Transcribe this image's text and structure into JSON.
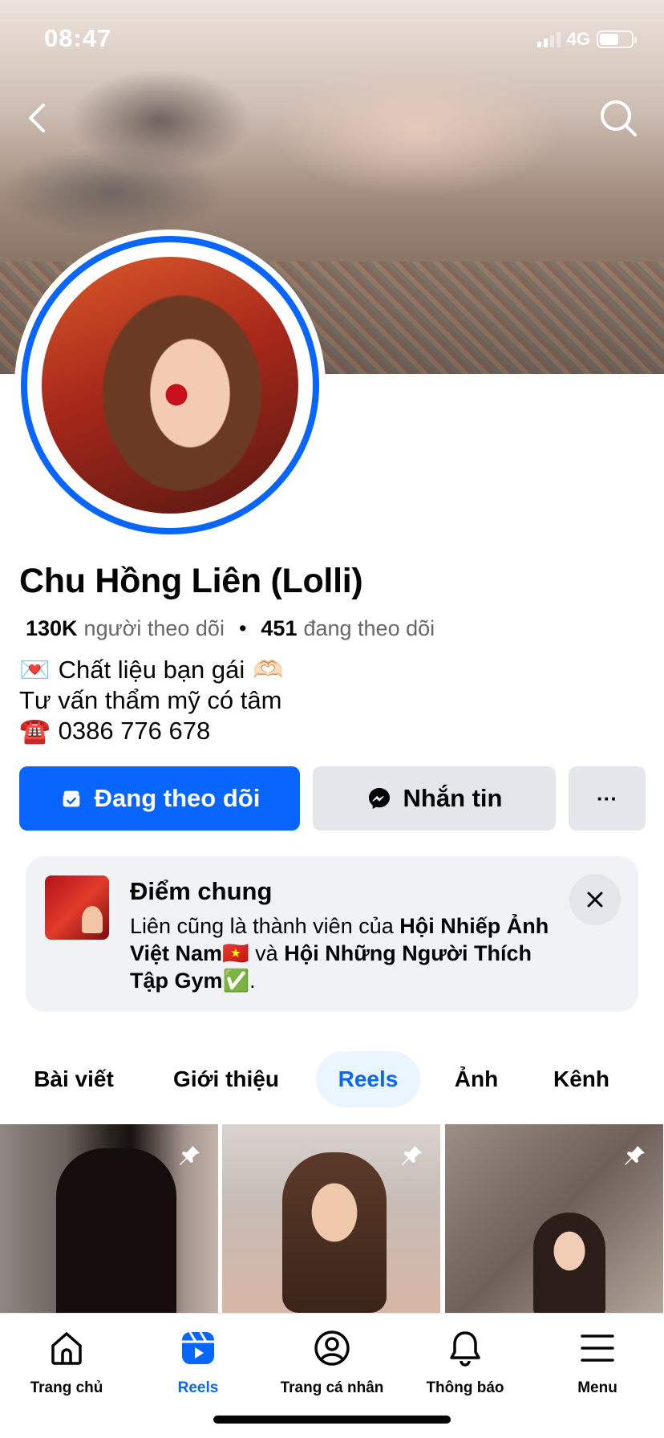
{
  "status_bar": {
    "time": "08:47",
    "network": "4G"
  },
  "profile": {
    "name": "Chu Hồng Liên (Lolli)",
    "followers_count": "130K",
    "followers_label": "người theo dõi",
    "following_count": "451",
    "following_label": "đang theo dõi",
    "separator": "•",
    "bio": [
      {
        "emoji": "💌",
        "text": "Chất liệu bạn gái",
        "trailing": "🫶🏻"
      },
      {
        "emoji": "",
        "text": "Tư vấn thẩm mỹ có tâm",
        "trailing": ""
      },
      {
        "emoji": "☎️",
        "text": "0386 776 678",
        "trailing": ""
      }
    ]
  },
  "actions": {
    "follow_label": "Đang theo dõi",
    "message_label": "Nhắn tin",
    "more_label": "···"
  },
  "mutual": {
    "title": "Điểm chung",
    "text_prefix": "Liên cũng là thành viên của ",
    "group1": "Hội Nhiếp Ảnh Việt Nam🇻🇳",
    "connector": " và ",
    "group2": "Hội Những Người Thích Tập Gym✅",
    "suffix": "."
  },
  "tabs": [
    {
      "label": "Bài viết",
      "active": false
    },
    {
      "label": "Giới thiệu",
      "active": false
    },
    {
      "label": "Reels",
      "active": true
    },
    {
      "label": "Ảnh",
      "active": false
    },
    {
      "label": "Kênh",
      "active": false
    }
  ],
  "bottom_nav": [
    {
      "label": "Trang chủ",
      "icon": "home-icon",
      "active": false
    },
    {
      "label": "Reels",
      "icon": "reels-icon",
      "active": true
    },
    {
      "label": "Trang cá nhân",
      "icon": "profile-icon",
      "active": false
    },
    {
      "label": "Thông báo",
      "icon": "bell-icon",
      "active": false
    },
    {
      "label": "Menu",
      "icon": "menu-icon",
      "active": false
    }
  ],
  "colors": {
    "accent": "#0866ff",
    "button_gray": "#e4e6eb",
    "card_bg": "#f0f2f5",
    "tab_active_bg": "#ebf5ff"
  }
}
